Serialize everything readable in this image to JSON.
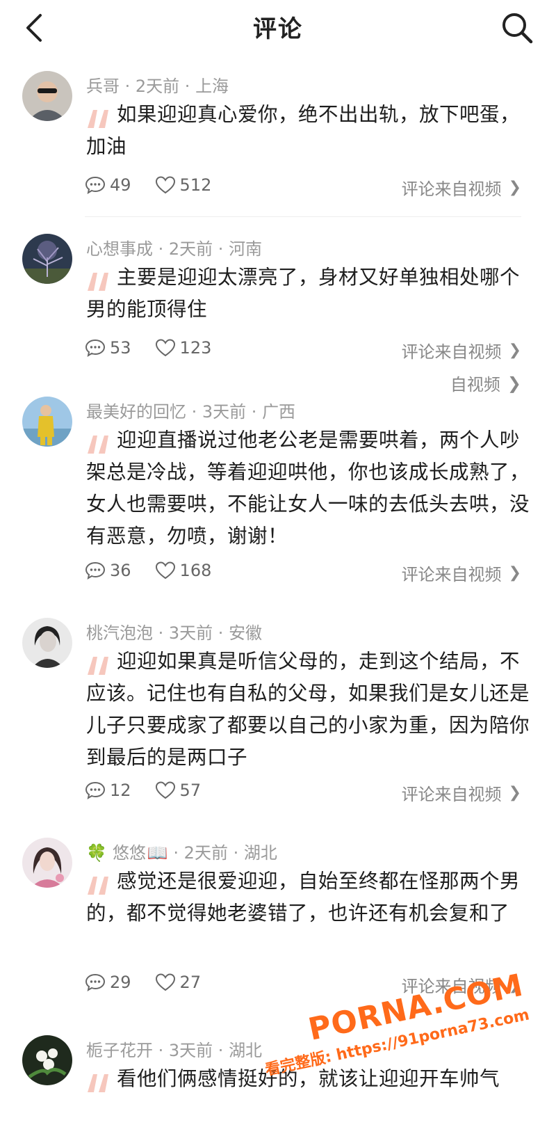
{
  "header": {
    "title": "评论",
    "back_icon": "chevron-left-icon",
    "search_icon": "search-icon"
  },
  "source_label": "评论来自视频",
  "comments": [
    {
      "author": "兵哥",
      "time": "2天前",
      "location": "上海",
      "text": "如果迎迎真心爱你，绝不出出轨，放下吧蛋，加油",
      "replies": "49",
      "likes": "512",
      "source": "评论来自视频"
    },
    {
      "author": "心想事成",
      "time": "2天前",
      "location": "河南",
      "text": "主要是迎迎太漂亮了，身材又好单独相处哪个男的能顶得住",
      "replies": "53",
      "likes": "123",
      "source": "评论来自视频"
    },
    {
      "author": "最美好的回忆",
      "time": "3天前",
      "location": "广西",
      "text": "迎迎直播说过他老公老是需要哄着，两个人吵架总是冷战，等着迎迎哄他，你也该成长成熟了，女人也需要哄，不能让女人一味的去低头去哄，没有恶意，勿喷，谢谢！",
      "replies": "36",
      "likes": "168",
      "source": "评论来自视频"
    },
    {
      "author": "桃汽泡泡",
      "time": "3天前",
      "location": "安徽",
      "text": "迎迎如果真是听信父母的，走到这个结局，不应该。记住也有自私的父母，如果我们是女儿还是儿子只要成家了都要以自己的小家为重，因为陪你到最后的是两口子",
      "replies": "12",
      "likes": "57",
      "source": "评论来自视频"
    },
    {
      "author": "悠悠",
      "time": "2天前",
      "location": "湖北",
      "text": "感觉还是很爱迎迎，自始至终都在怪那两个男的，都不觉得她老婆错了，也许还有机会复和了",
      "replies": "29",
      "likes": "27",
      "source": "评论来自视频"
    },
    {
      "author": "栀子花开",
      "time": "3天前",
      "location": "湖北",
      "text": "看他们俩感情挺好的，就该让迎迎开车帅气"
    }
  ],
  "ghost_text": "自视频",
  "watermark": {
    "main": "PORNA.COM",
    "sub": "看完整版: https://91porna73.com"
  },
  "colors": {
    "quote": "#f6c7bd",
    "meta": "#9a9a9a",
    "watermark": "#ff6a1a"
  }
}
